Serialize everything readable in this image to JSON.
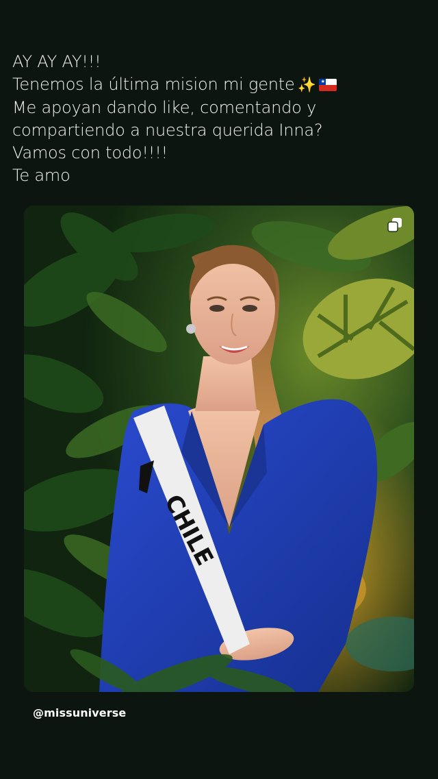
{
  "story": {
    "caption_lines": [
      "AY AY AY!!!",
      "Tenemos la última mision mi gente",
      "Me apoyan dando like, comentando y",
      "compartiendo a nuestra querida Inna?",
      "Vamos con todo!!!!",
      "Te amo"
    ],
    "caption_emojis": [
      "sparkles-icon",
      "chile-flag-icon"
    ]
  },
  "post": {
    "sash_text": "CHILE",
    "handle": "@missuniverse",
    "multi_image_icon": "carousel-icon"
  },
  "colors": {
    "background": "#0c1510",
    "dress": "#1f3fb0",
    "foliage": "#2f5a22",
    "sash": "#efeeee"
  }
}
